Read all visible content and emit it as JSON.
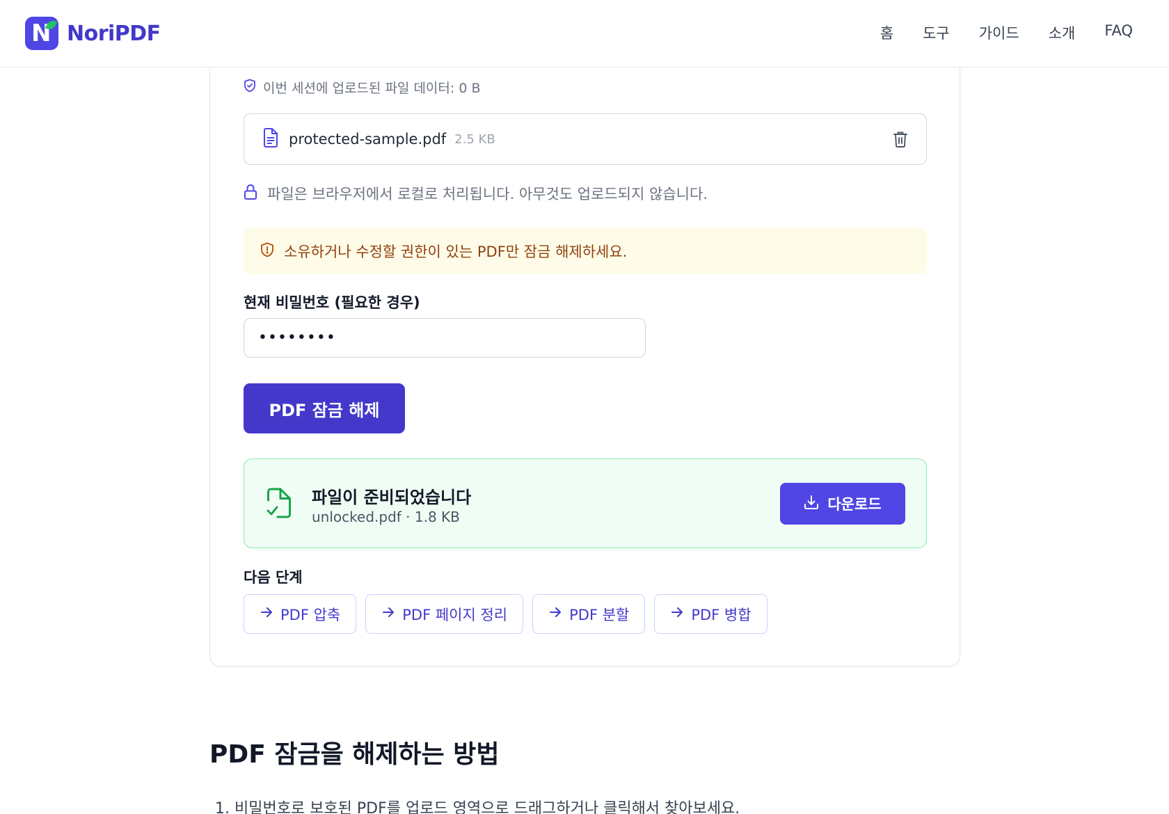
{
  "header": {
    "brand": "NoriPDF",
    "logo_letter": "N",
    "nav": [
      "홈",
      "도구",
      "가이드",
      "소개",
      "FAQ"
    ]
  },
  "session": {
    "text": "이번 세션에 업로드된 파일 데이터: 0 B"
  },
  "file": {
    "name": "protected-sample.pdf",
    "size": "2.5 KB"
  },
  "local_note": "파일은 브라우저에서 로컬로 처리됩니다. 아무것도 업로드되지 않습니다.",
  "warning": "소유하거나 수정할 권한이 있는 PDF만 잠금 해제하세요.",
  "password": {
    "label": "현재 비밀번호 (필요한 경우)",
    "value": "••••••••"
  },
  "unlock_button": "PDF 잠금 해제",
  "result": {
    "title": "파일이 준비되었습니다",
    "subtitle": "unlocked.pdf · 1.8 KB",
    "download_label": "다운로드"
  },
  "next_steps": {
    "label": "다음 단계",
    "items": [
      "PDF 압축",
      "PDF 페이지 정리",
      "PDF 분할",
      "PDF 병합"
    ]
  },
  "howto": {
    "title": "PDF 잠금을 해제하는 방법",
    "steps": [
      "1. 비밀번호로 보호된 PDF를 업로드 영역으로 드래그하거나 클릭해서 찾아보세요."
    ]
  },
  "colors": {
    "accent": "#4f46e5",
    "accent_dark": "#4338ca",
    "warning_bg": "#fefce8",
    "success_bg": "#f0fdf4",
    "success_icon": "#16a34a"
  },
  "icons": [
    "shield-check-icon",
    "document-icon",
    "trash-icon",
    "lock-icon",
    "shield-alert-icon",
    "file-check-icon",
    "download-icon",
    "arrow-right-icon"
  ]
}
